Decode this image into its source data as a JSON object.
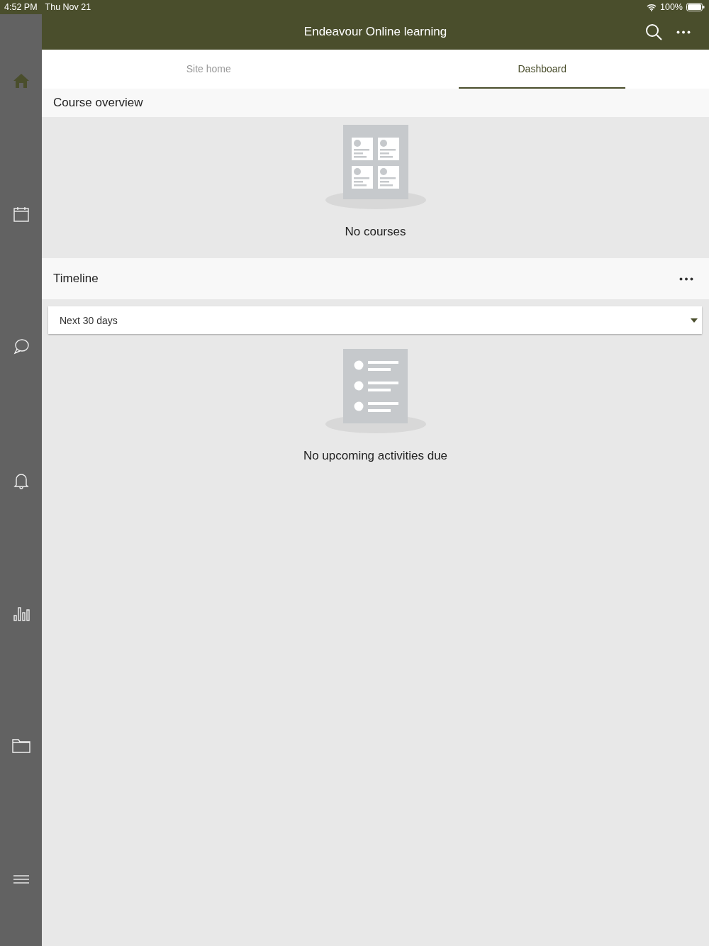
{
  "status_bar": {
    "time": "4:52 PM",
    "date": "Thu Nov 21",
    "battery": "100%"
  },
  "header": {
    "title": "Endeavour Online learning"
  },
  "sidebar": {
    "items": [
      {
        "kind": "home",
        "selected": true
      },
      {
        "kind": "calendar",
        "selected": false
      },
      {
        "kind": "messages",
        "selected": false
      },
      {
        "kind": "notifications",
        "selected": false
      },
      {
        "kind": "grades",
        "selected": false
      },
      {
        "kind": "files",
        "selected": false
      },
      {
        "kind": "more",
        "selected": false
      }
    ]
  },
  "tabs": [
    {
      "label": "Site home",
      "selected": false
    },
    {
      "label": "Dashboard",
      "selected": true
    }
  ],
  "course_overview": {
    "title": "Course overview",
    "empty_text": "No courses"
  },
  "timeline": {
    "title": "Timeline",
    "filter": "Next 30 days",
    "empty_text": "No upcoming activities due"
  }
}
